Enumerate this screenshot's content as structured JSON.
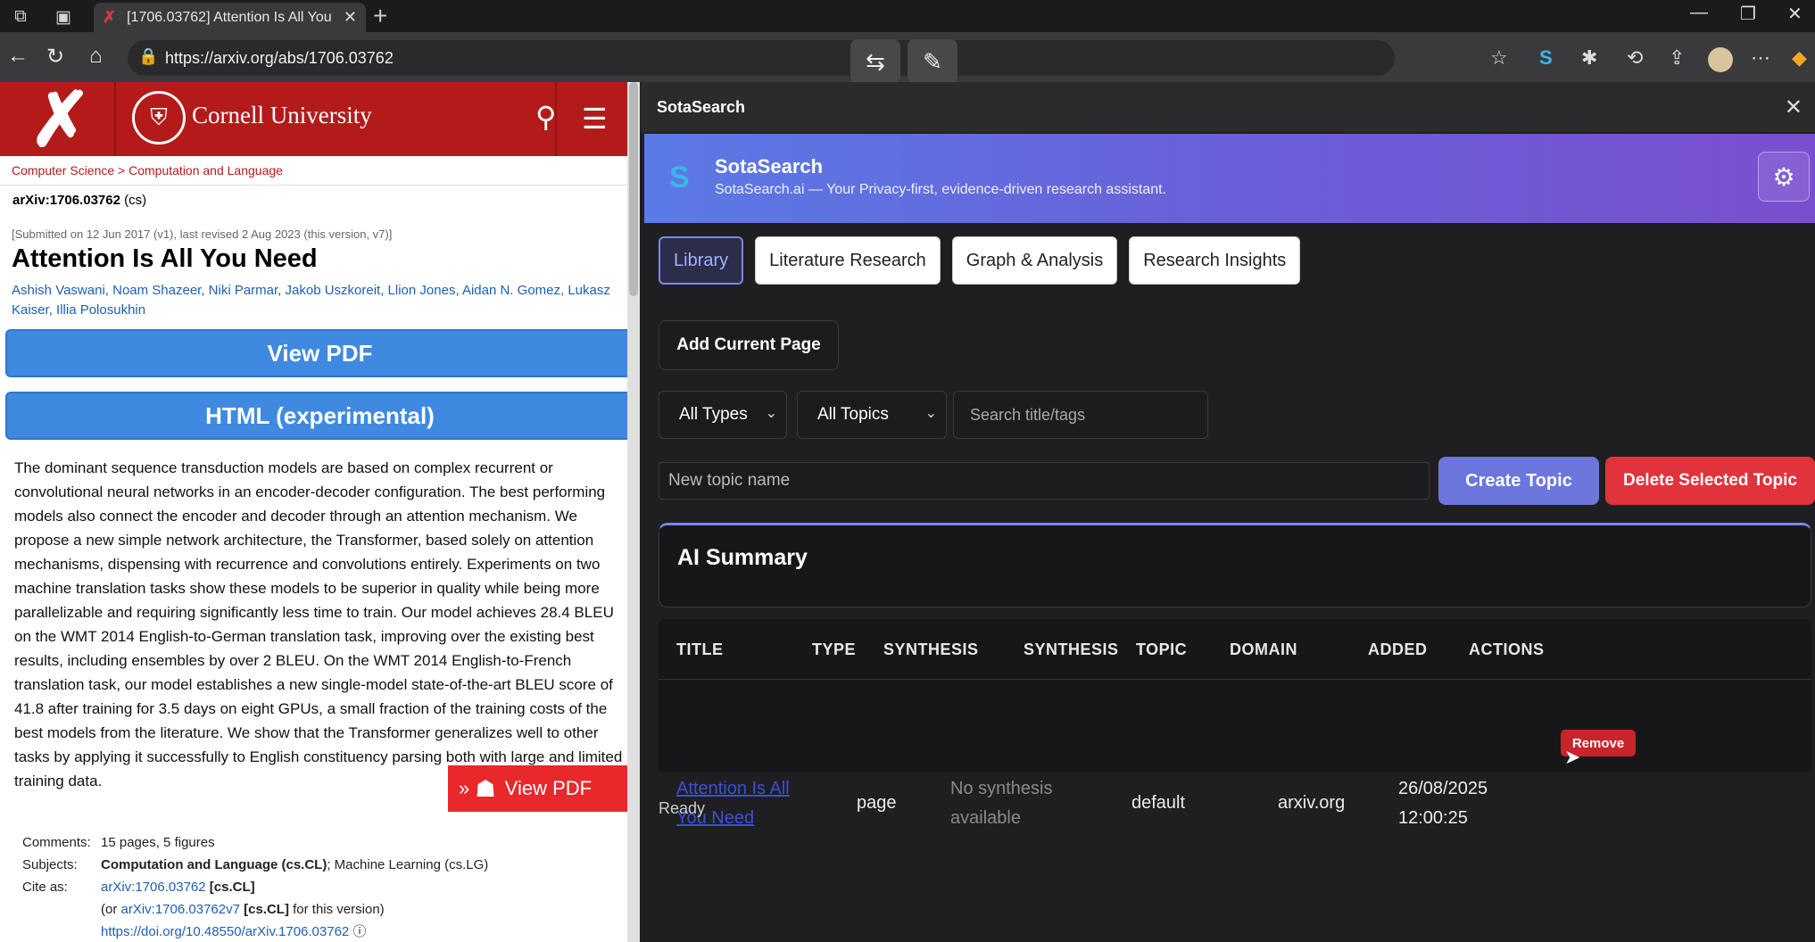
{
  "browser": {
    "tab_title": "[1706.03762] Attention Is All You",
    "url": "https://arxiv.org/abs/1706.03762"
  },
  "arxiv": {
    "university": "Cornell University",
    "breadcrumb": "Computer Science > Computation and Language",
    "arxiv_id": "arXiv:1706.03762",
    "arxiv_cat": " (cs)",
    "submitted": "[Submitted on 12 Jun 2017 (v1), last revised 2 Aug 2023 (this version, v7)]",
    "title": "Attention Is All You Need",
    "authors": "Ashish Vaswani, Noam Shazeer, Niki Parmar, Jakob Uszkoreit, Llion Jones, Aidan N. Gomez, Lukasz Kaiser, Illia Polosukhin",
    "view_pdf": "View PDF",
    "html_exp": "HTML (experimental)",
    "abstract": "The dominant sequence transduction models are based on complex recurrent or convolutional neural networks in an encoder-decoder configuration. The best performing models also connect the encoder and decoder through an attention mechanism. We propose a new simple network architecture, the Transformer, based solely on attention mechanisms, dispensing with recurrence and convolutions entirely. Experiments on two machine translation tasks show these models to be superior in quality while being more parallelizable and requiring significantly less time to train. Our model achieves 28.4 BLEU on the WMT 2014 English-to-German translation task, improving over the existing best results, including ensembles by over 2 BLEU. On the WMT 2014 English-to-French translation task, our model establishes a new single-model state-of-the-art BLEU score of 41.8 after training for 3.5 days on eight GPUs, a small fraction of the training costs of the best models from the literature. We show that the Transformer generalizes well to other tasks by applying it successfully to English constituency parsing both with large and limited training data.",
    "comments_label": "Comments:",
    "comments": "15 pages, 5 figures",
    "subjects_label": "Subjects:",
    "subjects_main": "Computation and Language (cs.CL)",
    "subjects_rest": "; Machine Learning (cs.LG)",
    "cite_label": "Cite as:",
    "cite_link": "arXiv:1706.03762",
    "cite_cat": " [cs.CL]",
    "cite_ver_pre": "(or ",
    "cite_ver_link": "arXiv:1706.03762v7",
    "cite_ver_cat": " [cs.CL]",
    "cite_ver_post": " for this version)",
    "doi": "https://doi.org/10.48550/arXiv.1706.03762",
    "mendeley_label": "View PDF"
  },
  "panel": {
    "header": "SotaSearch",
    "brand": "SotaSearch",
    "tagline": "SotaSearch.ai — Your Privacy-first, evidence-driven research assistant.",
    "tabs": [
      "Library",
      "Literature Research",
      "Graph & Analysis",
      "Research Insights"
    ],
    "add_current": "Add Current Page",
    "filter_types": "All Types",
    "filter_topics": "All Topics",
    "search_placeholder": "Search title/tags",
    "topic_placeholder": "New topic name",
    "create_topic": "Create Topic",
    "delete_topic": "Delete Selected Topic",
    "summary_title": "AI Summary",
    "columns": [
      "TITLE",
      "TYPE",
      "SYNTHESIS",
      "SYNTHESIS",
      "TOPIC",
      "DOMAIN",
      "ADDED",
      "ACTIONS"
    ],
    "row": {
      "title": "Attention Is All You Need",
      "type": "page",
      "synthesis": "No synthesis available",
      "synthesis2": "default",
      "topic": "arxiv.org",
      "added": "26/08/2025 12:00:25",
      "action": "Remove"
    },
    "status": "Ready"
  }
}
